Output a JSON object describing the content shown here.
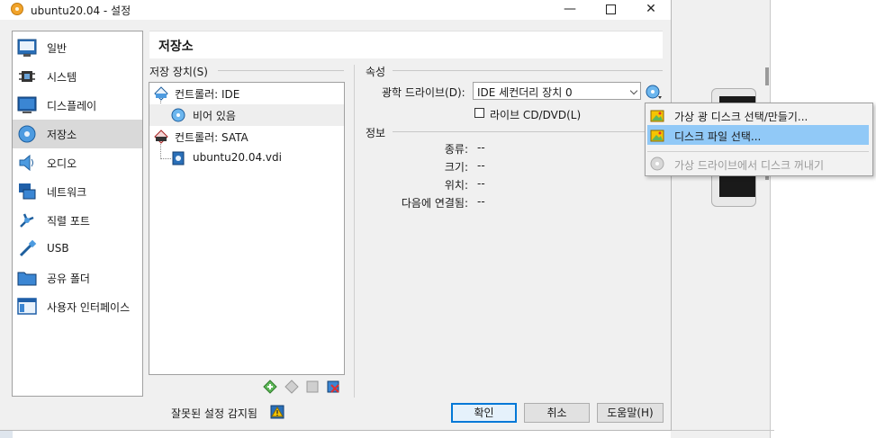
{
  "window": {
    "title": "ubuntu20.04 - 설정"
  },
  "sidebar": {
    "items": [
      {
        "label": "일반",
        "icon": "general-icon"
      },
      {
        "label": "시스템",
        "icon": "chip-icon"
      },
      {
        "label": "디스플레이",
        "icon": "monitor-icon"
      },
      {
        "label": "저장소",
        "icon": "disk-icon",
        "selected": true
      },
      {
        "label": "오디오",
        "icon": "speaker-icon"
      },
      {
        "label": "네트워크",
        "icon": "network-icon"
      },
      {
        "label": "직렬 포트",
        "icon": "serial-port-icon"
      },
      {
        "label": "USB",
        "icon": "usb-icon"
      },
      {
        "label": "공유 폴더",
        "icon": "folder-icon"
      },
      {
        "label": "사용자 인터페이스",
        "icon": "ui-icon"
      }
    ]
  },
  "page": {
    "title": "저장소"
  },
  "storage": {
    "devices_label": "저장 장치(S)",
    "tree": [
      {
        "label": "컨트롤러: IDE",
        "type": "controller"
      },
      {
        "label": "비어 있음",
        "type": "optical",
        "selected": true
      },
      {
        "label": "컨트롤러: SATA",
        "type": "controller"
      },
      {
        "label": "ubuntu20.04.vdi",
        "type": "hdd"
      }
    ]
  },
  "attributes": {
    "section_label": "속성",
    "optical_drive_label": "광학 드라이브(D):",
    "optical_drive_value": "IDE 세컨더리 장치 0",
    "live_cd_label": "라이브 CD/DVD(L)"
  },
  "info": {
    "section_label": "정보",
    "rows": [
      {
        "label": "종류:",
        "value": "--"
      },
      {
        "label": "크기:",
        "value": "--"
      },
      {
        "label": "위치:",
        "value": "--"
      },
      {
        "label": "다음에 연결됨:",
        "value": "--"
      }
    ]
  },
  "popup_menu": {
    "items": [
      {
        "label": "가상 광 디스크 선택/만들기...",
        "state": "normal"
      },
      {
        "label": "디스크 파일 선택...",
        "state": "highlighted"
      },
      {
        "label": "가상 드라이브에서 디스크 꺼내기",
        "state": "disabled"
      }
    ]
  },
  "footer": {
    "status": "잘못된 설정 감지됨",
    "ok": "확인",
    "cancel": "취소",
    "help": "도움말(H)"
  },
  "colors": {
    "highlight": "#91c9f7",
    "selected": "#d9d9d9",
    "accent": "#0078d7"
  }
}
